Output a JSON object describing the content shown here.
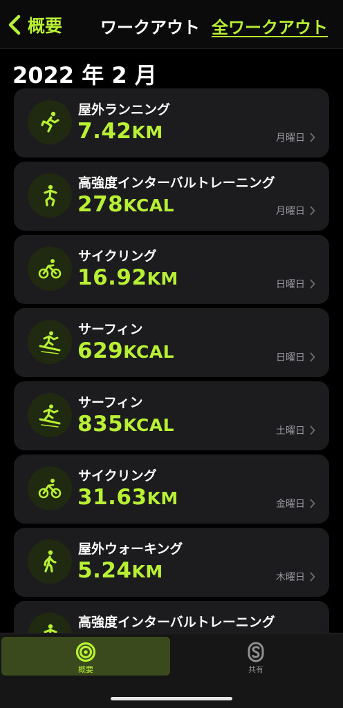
{
  "nav": {
    "back_label": "概要",
    "title": "ワークアウト",
    "all_label": "全ワークアウト"
  },
  "section": {
    "title": "2022 年 2 月"
  },
  "workouts": [
    {
      "name": "屋外ランニング",
      "value": "7.42",
      "unit": "KM",
      "day": "月曜日",
      "icon": "running-icon"
    },
    {
      "name": "高強度インターバルトレーニング",
      "value": "278",
      "unit": "KCAL",
      "day": "月曜日",
      "icon": "hiit-icon"
    },
    {
      "name": "サイクリング",
      "value": "16.92",
      "unit": "KM",
      "day": "日曜日",
      "icon": "cycling-icon"
    },
    {
      "name": "サーフィン",
      "value": "629",
      "unit": "KCAL",
      "day": "日曜日",
      "icon": "surfing-icon"
    },
    {
      "name": "サーフィン",
      "value": "835",
      "unit": "KCAL",
      "day": "土曜日",
      "icon": "surfing-icon"
    },
    {
      "name": "サイクリング",
      "value": "31.63",
      "unit": "KM",
      "day": "金曜日",
      "icon": "cycling-icon"
    },
    {
      "name": "屋外ウォーキング",
      "value": "5.24",
      "unit": "KM",
      "day": "木曜日",
      "icon": "walking-icon"
    },
    {
      "name": "高強度インターバルトレーニング",
      "value": "",
      "unit": "",
      "day": "",
      "icon": "hiit-icon"
    }
  ],
  "tabbar": {
    "summary_label": "概要",
    "summary_icon": "activity-rings-icon",
    "sharing_label": "共有",
    "sharing_icon": "sharing-icon"
  },
  "colors": {
    "accent": "#b8f133",
    "card": "#1c1c1e",
    "background": "#000000",
    "secondary_text": "#9a9aa0"
  }
}
